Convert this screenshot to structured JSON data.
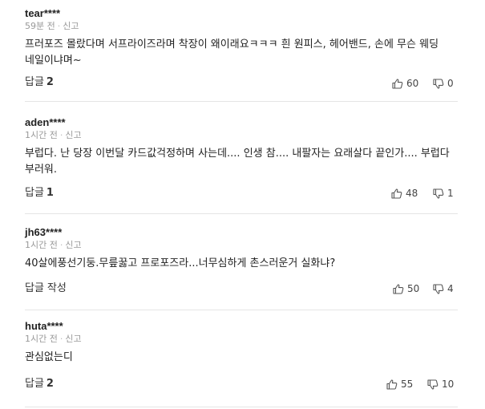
{
  "labels": {
    "reply": "답글",
    "report": "신고",
    "write_reply": "작성"
  },
  "comments": [
    {
      "author": "tear****",
      "time": "59분 전",
      "text": "프러포즈 몰랐다며 서프라이즈라며 착장이 왜이래요ㅋㅋㅋ 흰 원피스, 헤어밴드, 손에 무슨 웨딩 네일이냐며~",
      "reply_count": "2",
      "likes": "60",
      "dislikes": "0"
    },
    {
      "author": "aden****",
      "time": "1시간 전",
      "text": "부럽다. 난 당장 이번달 카드값걱정하며 사는데.... 인생 참.... 내팔자는 요래살다 끝인가.... 부럽다 부러워.",
      "reply_count": "1",
      "likes": "48",
      "dislikes": "1"
    },
    {
      "author": "jh63****",
      "time": "1시간 전",
      "text": "40살에풍선기둥.무릎꿇고 프로포즈라...너무심하게 촌스러운거 실화냐?",
      "reply_count": "",
      "likes": "50",
      "dislikes": "4"
    },
    {
      "author": "huta****",
      "time": "1시간 전",
      "text": "관심없는디",
      "reply_count": "2",
      "likes": "55",
      "dislikes": "10"
    }
  ],
  "icons": {
    "like": "thumbs-up-outline-icon",
    "dislike": "thumbs-down-outline-icon"
  },
  "colors": {
    "text": "#222222",
    "meta": "#999999",
    "divider": "#e5e5e5"
  }
}
